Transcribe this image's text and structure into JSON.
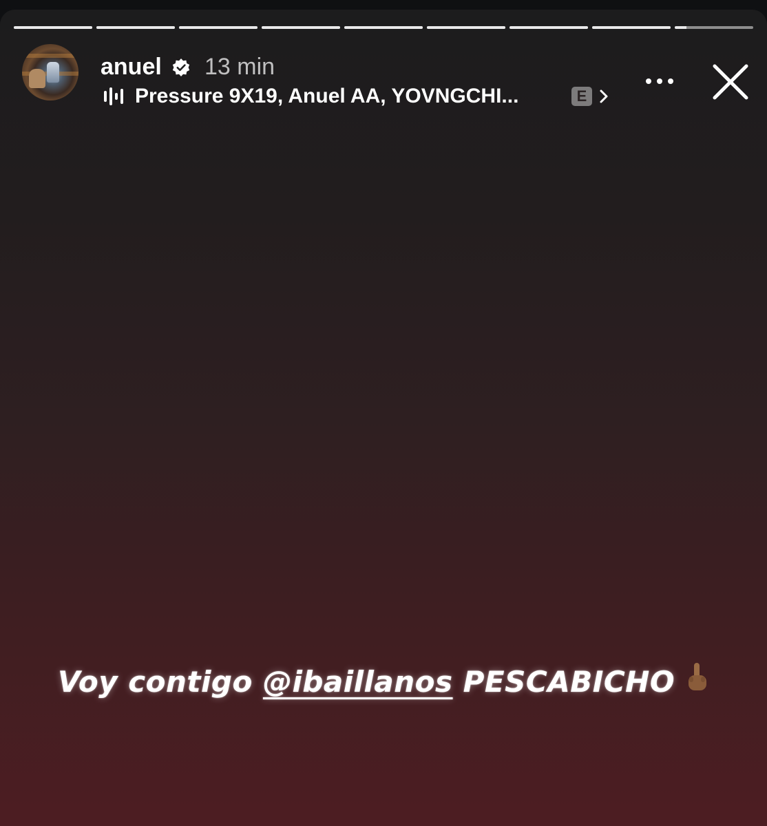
{
  "story": {
    "segment_count": 9,
    "segments_viewed": 8,
    "current_progress": 0.15,
    "background_top": "#1c1c1d",
    "background_bottom": "#4d1d22"
  },
  "header": {
    "username": "anuel",
    "verified_icon": "verified-badge-icon",
    "time_ago": "13 min",
    "music": {
      "icon": "equalizer-icon",
      "track": "Pressure 9X19, Anuel AA, YOVNGCHI...",
      "explicit_label": "E"
    },
    "more_icon": "more-dots-icon",
    "close_icon": "close-icon"
  },
  "caption": {
    "text_before": "Voy contigo ",
    "mention": "@ibaillanos",
    "text_after": " PESCABICHO",
    "emoji": "🖕🏽"
  }
}
